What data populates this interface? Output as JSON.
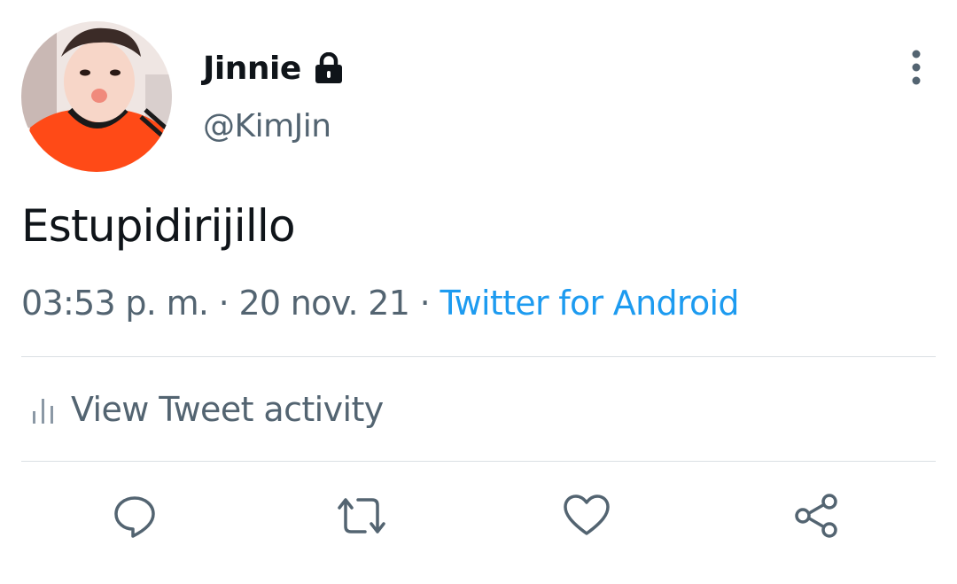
{
  "user": {
    "display_name": "Jinnie",
    "handle": "@KimJin",
    "protected_icon": "lock-icon",
    "avatar_icon": "profile-photo"
  },
  "tweet": {
    "text": "Estupidirijillo",
    "time": "03:53 p. m.",
    "separator": "·",
    "date": "20 nov. 21",
    "source": "Twitter for Android"
  },
  "activity": {
    "label": "View Tweet activity",
    "icon": "bar-chart-icon"
  },
  "actions": [
    {
      "name": "reply",
      "icon": "reply-icon"
    },
    {
      "name": "retweet",
      "icon": "retweet-icon"
    },
    {
      "name": "like",
      "icon": "heart-icon"
    },
    {
      "name": "share",
      "icon": "share-icon"
    }
  ],
  "colors": {
    "text_primary": "#0f1419",
    "text_secondary": "#536471",
    "link": "#1d9bf0",
    "divider": "#dadfe3"
  }
}
